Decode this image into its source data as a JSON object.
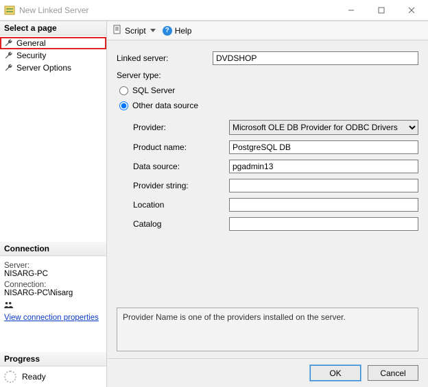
{
  "window": {
    "title": "New Linked Server"
  },
  "left": {
    "select_page": "Select a page",
    "pages": [
      {
        "label": "General"
      },
      {
        "label": "Security"
      },
      {
        "label": "Server Options"
      }
    ],
    "connection_hdr": "Connection",
    "server_lbl": "Server:",
    "server_val": "NISARG-PC",
    "conn_lbl": "Connection:",
    "conn_val": "NISARG-PC\\Nisarg",
    "view_props": "View connection properties",
    "progress_hdr": "Progress",
    "progress_status": "Ready"
  },
  "toolbar": {
    "script": "Script",
    "help": "Help"
  },
  "form": {
    "linked_server_lbl": "Linked server:",
    "linked_server_val": "DVDSHOP",
    "server_type_lbl": "Server type:",
    "radio_sql": "SQL Server",
    "radio_other": "Other data source",
    "provider_lbl": "Provider:",
    "provider_val": "Microsoft OLE DB Provider for ODBC Drivers",
    "product_lbl": "Product name:",
    "product_val": "PostgreSQL DB",
    "datasource_lbl": "Data source:",
    "datasource_val": "pgadmin13",
    "provstr_lbl": "Provider string:",
    "provstr_val": "",
    "location_lbl": "Location",
    "location_val": "",
    "catalog_lbl": "Catalog",
    "catalog_val": "",
    "hint": "Provider Name is one of the providers installed on the server."
  },
  "buttons": {
    "ok": "OK",
    "cancel": "Cancel"
  }
}
